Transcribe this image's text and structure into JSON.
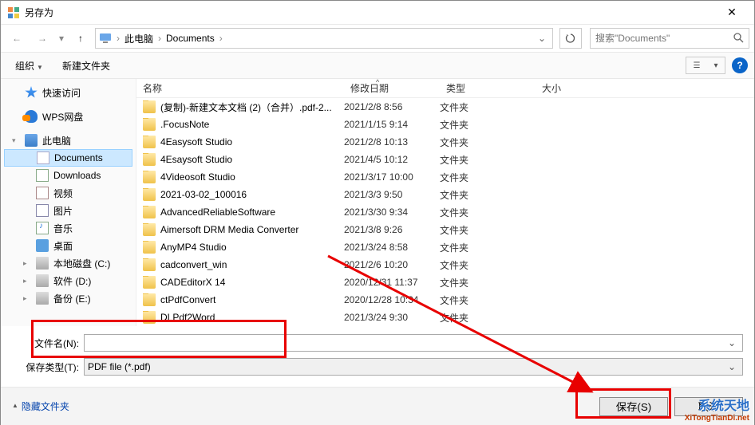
{
  "title": "另存为",
  "breadcrumb": {
    "root": "此电脑",
    "folder": "Documents"
  },
  "search": {
    "placeholder": "搜索\"Documents\""
  },
  "toolbar": {
    "organize": "组织",
    "new_folder": "新建文件夹"
  },
  "columns": {
    "name": "名称",
    "date": "修改日期",
    "type": "类型",
    "size": "大小"
  },
  "sidebar": [
    {
      "label": "快速访问",
      "icon": "i-star",
      "exp": ""
    },
    {
      "label": "WPS网盘",
      "icon": "i-cloud",
      "exp": ""
    },
    {
      "label": "此电脑",
      "icon": "i-pc",
      "exp": "▾"
    },
    {
      "label": "Documents",
      "icon": "i-doc",
      "indent": true,
      "selected": true
    },
    {
      "label": "Downloads",
      "icon": "i-dl",
      "indent": true
    },
    {
      "label": "视频",
      "icon": "i-video",
      "indent": true
    },
    {
      "label": "图片",
      "icon": "i-pic",
      "indent": true
    },
    {
      "label": "音乐",
      "icon": "i-music",
      "indent": true
    },
    {
      "label": "桌面",
      "icon": "i-desk",
      "indent": true
    },
    {
      "label": "本地磁盘 (C:)",
      "icon": "i-disk",
      "indent": true,
      "exp": "▸"
    },
    {
      "label": "软件 (D:)",
      "icon": "i-disk",
      "indent": true,
      "exp": "▸"
    },
    {
      "label": "备份 (E:)",
      "icon": "i-disk",
      "indent": true,
      "exp": "▸"
    }
  ],
  "files": [
    {
      "name": "(复制)-新建文本文档 (2)（合并）.pdf-2...",
      "date": "2021/2/8 8:56",
      "type": "文件夹"
    },
    {
      "name": ".FocusNote",
      "date": "2021/1/15 9:14",
      "type": "文件夹"
    },
    {
      "name": "4Easysoft Studio",
      "date": "2021/2/8 10:13",
      "type": "文件夹"
    },
    {
      "name": "4Esaysoft Studio",
      "date": "2021/4/5 10:12",
      "type": "文件夹"
    },
    {
      "name": "4Videosoft Studio",
      "date": "2021/3/17 10:00",
      "type": "文件夹"
    },
    {
      "name": "2021-03-02_100016",
      "date": "2021/3/3 9:50",
      "type": "文件夹"
    },
    {
      "name": "AdvancedReliableSoftware",
      "date": "2021/3/30 9:34",
      "type": "文件夹"
    },
    {
      "name": "Aimersoft DRM Media Converter",
      "date": "2021/3/8 9:26",
      "type": "文件夹"
    },
    {
      "name": "AnyMP4 Studio",
      "date": "2021/3/24 8:58",
      "type": "文件夹"
    },
    {
      "name": "cadconvert_win",
      "date": "2021/2/6 10:20",
      "type": "文件夹"
    },
    {
      "name": "CADEditorX 14",
      "date": "2020/12/31 11:37",
      "type": "文件夹"
    },
    {
      "name": "ctPdfConvert",
      "date": "2020/12/28 10:34",
      "type": "文件夹"
    },
    {
      "name": "DLPdf2Word",
      "date": "2021/3/24 9:30",
      "type": "文件夹"
    }
  ],
  "fields": {
    "filename_label": "文件名(N):",
    "filename_value": "",
    "filetype_label": "保存类型(T):",
    "filetype_value": "PDF file (*.pdf)"
  },
  "footer": {
    "hide_folders": "隐藏文件夹",
    "save": "保存(S)",
    "cancel": "取消"
  },
  "watermark": {
    "line1": "系统天地",
    "line2": "XiTongTianDi.net"
  }
}
